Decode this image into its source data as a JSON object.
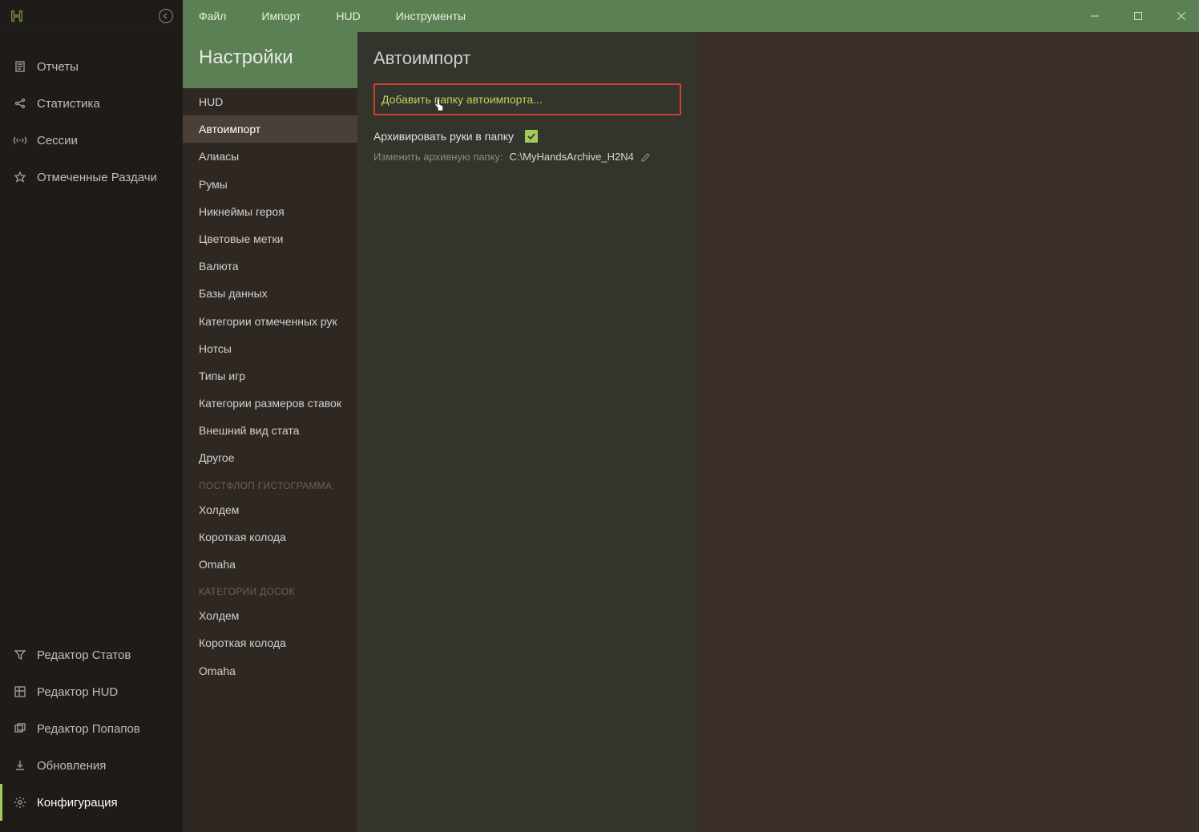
{
  "menubar": {
    "items": [
      "Файл",
      "Импорт",
      "HUD",
      "Инструменты"
    ]
  },
  "sidebar": {
    "top": [
      {
        "key": "reports",
        "label": "Отчеты",
        "icon": "document"
      },
      {
        "key": "stats",
        "label": "Статистика",
        "icon": "share"
      },
      {
        "key": "sessions",
        "label": "Сессии",
        "icon": "broadcast"
      },
      {
        "key": "marked",
        "label": "Отмеченные Раздачи",
        "icon": "star"
      }
    ],
    "bottom": [
      {
        "key": "stat-editor",
        "label": "Редактор Статов",
        "icon": "funnel"
      },
      {
        "key": "hud-editor",
        "label": "Редактор HUD",
        "icon": "grid"
      },
      {
        "key": "popup-editor",
        "label": "Редактор Попапов",
        "icon": "windows"
      },
      {
        "key": "updates",
        "label": "Обновления",
        "icon": "download"
      },
      {
        "key": "config",
        "label": "Конфигурация",
        "icon": "gear",
        "active": true
      }
    ]
  },
  "settings": {
    "title": "Настройки",
    "items": [
      {
        "label": "HUD"
      },
      {
        "label": "Автоимпорт",
        "selected": true
      },
      {
        "label": "Алиасы"
      },
      {
        "label": "Румы"
      },
      {
        "label": "Никнеймы героя"
      },
      {
        "label": "Цветовые метки"
      },
      {
        "label": "Валюта"
      },
      {
        "label": "Базы данных"
      },
      {
        "label": "Категории отмеченных рук"
      },
      {
        "label": "Нотсы"
      },
      {
        "label": "Типы игр"
      },
      {
        "label": "Категории размеров ставок"
      },
      {
        "label": "Внешний вид стата"
      },
      {
        "label": "Другое"
      },
      {
        "category": "ПОСТФЛОП ГИСТОГРАММА"
      },
      {
        "label": "Холдем"
      },
      {
        "label": "Короткая колода"
      },
      {
        "label": "Omaha"
      },
      {
        "category": "КАТЕГОРИИ ДОСОК"
      },
      {
        "label": "Холдем"
      },
      {
        "label": "Короткая колода"
      },
      {
        "label": "Omaha"
      }
    ]
  },
  "panel": {
    "title": "Автоимпорт",
    "addFolder": "Добавить папку автоимпорта...",
    "archiveLabel": "Архивировать руки в папку",
    "archiveChecked": true,
    "archiveChangeLabel": "Изменить архивную папку:",
    "archivePath": "C:\\MyHandsArchive_H2N4"
  }
}
